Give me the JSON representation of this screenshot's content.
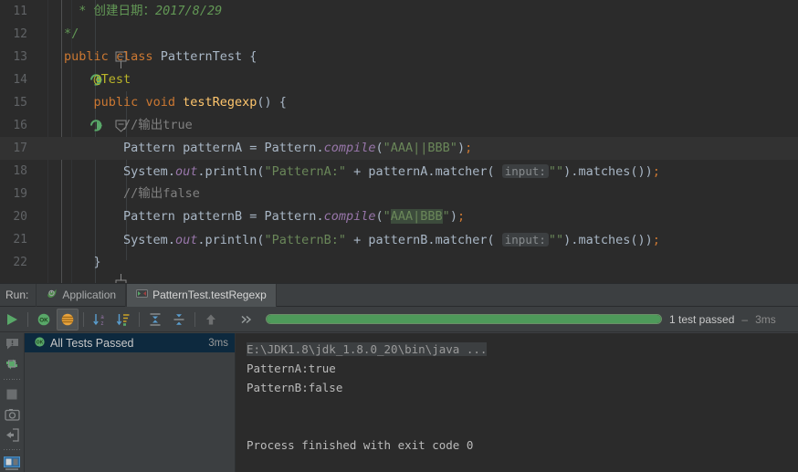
{
  "editor": {
    "lines": [
      {
        "num": "11",
        "gutter": "none",
        "fold": "none",
        "indent": 1,
        "current": false,
        "text": "  * 创建日期：2017/8/29"
      },
      {
        "num": "12",
        "gutter": "none",
        "fold": "fold-end",
        "indent": 1,
        "current": false,
        "text": "  */"
      },
      {
        "num": "13",
        "gutter": "run-class",
        "fold": "none",
        "indent": 0,
        "current": false,
        "text": "public class PatternTest {"
      },
      {
        "num": "14",
        "gutter": "none",
        "fold": "none",
        "indent": 1,
        "current": false,
        "text": "    @Test"
      },
      {
        "num": "15",
        "gutter": "run-method",
        "fold": "fold-open",
        "indent": 1,
        "current": false,
        "text": "    public void testRegexp() {"
      },
      {
        "num": "16",
        "gutter": "none",
        "fold": "none",
        "indent": 2,
        "current": false,
        "text": "        //输出true"
      },
      {
        "num": "17",
        "gutter": "none",
        "fold": "none",
        "indent": 2,
        "current": true,
        "text": "        Pattern patternA = Pattern.compile(\"AAA||BBB\");"
      },
      {
        "num": "18",
        "gutter": "none",
        "fold": "none",
        "indent": 2,
        "current": false,
        "text": "        System.out.println(\"PatternA:\" + patternA.matcher( input: \"\").matches());"
      },
      {
        "num": "19",
        "gutter": "none",
        "fold": "none",
        "indent": 2,
        "current": false,
        "text": "        //输出false"
      },
      {
        "num": "20",
        "gutter": "none",
        "fold": "none",
        "indent": 2,
        "current": false,
        "text": "        Pattern patternB = Pattern.compile(\"AAA|BBB\");"
      },
      {
        "num": "21",
        "gutter": "none",
        "fold": "none",
        "indent": 2,
        "current": false,
        "text": "        System.out.println(\"PatternB:\" + patternB.matcher( input: \"\").matches());"
      },
      {
        "num": "22",
        "gutter": "none",
        "fold": "fold-end",
        "indent": 1,
        "current": false,
        "text": "    }"
      }
    ],
    "tokens": {
      "doc_star": "*",
      "doc_label": "创建日期：",
      "doc_date": "2017/8/29",
      "doc_close": "*/",
      "kw_public": "public",
      "kw_class": "class",
      "kw_void": "void",
      "class_name": "PatternTest",
      "annotation": "@Test",
      "method_name": "testRegexp",
      "comment_true": "//输出true",
      "comment_false": "//输出false",
      "type_pattern": "Pattern",
      "var_a": "patternA",
      "var_b": "patternB",
      "compile": "compile",
      "regex_a": "AAA||BBB",
      "regex_b": "AAA|BBB",
      "system": "System",
      "out": "out",
      "println": "println",
      "label_a": "PatternA:",
      "label_b": "PatternB:",
      "matcher": "matcher",
      "param_hint": "input:",
      "matches": "matches"
    }
  },
  "runpanel": {
    "run_label": "Run:",
    "tabs": [
      {
        "label": "Application",
        "icon": "spring-leaf-icon",
        "active": false
      },
      {
        "label": "PatternTest.testRegexp",
        "icon": "test-run-icon",
        "active": true
      }
    ],
    "toolbar": [
      {
        "name": "rerun-button",
        "icon": "green-play-icon",
        "pressed": false
      },
      {
        "name": "show-passed-button",
        "icon": "ok-badge-icon",
        "pressed": false
      },
      {
        "name": "show-ignored-button",
        "icon": "orange-filter-icon",
        "pressed": true
      },
      {
        "name": "sort-alphabetically-button",
        "icon": "sort-az-icon",
        "pressed": false
      },
      {
        "name": "sort-by-duration-button",
        "icon": "sort-duration-icon",
        "pressed": false
      },
      {
        "name": "expand-all-button",
        "icon": "expand-all-icon",
        "pressed": false
      },
      {
        "name": "collapse-all-button",
        "icon": "collapse-all-icon",
        "pressed": false
      },
      {
        "name": "previous-failed-button",
        "icon": "up-arrow-icon",
        "pressed": false
      },
      {
        "name": "more-options-button",
        "icon": "chevron-double-right-icon",
        "pressed": false
      }
    ],
    "progress": {
      "percent": 100,
      "status": "1 test passed",
      "separator": " – ",
      "time": "3ms",
      "bar_color": "#4e9a5a"
    },
    "rail_icons": [
      "alert-balloon-icon",
      "rerun-tests-icon",
      "stop-icon",
      "screenshot-icon",
      "export-icon",
      "console-layout-icon"
    ],
    "tree": [
      {
        "label": "All Tests Passed",
        "duration": "3ms",
        "icon": "ok-badge-icon",
        "selected": true
      }
    ],
    "console": [
      {
        "text": "E:\\JDK1.8\\jdk_1.8.0_20\\bin\\java ...",
        "style": "command"
      },
      {
        "text": "PatternA:true",
        "style": "plain"
      },
      {
        "text": "PatternB:false",
        "style": "plain"
      },
      {
        "text": "",
        "style": "blank"
      },
      {
        "text": "",
        "style": "blank"
      },
      {
        "text": "Process finished with exit code 0",
        "style": "plain"
      }
    ]
  },
  "colors": {
    "editor_bg": "#2b2b2b",
    "panel_bg": "#3c3f41",
    "current_line": "#323232",
    "selection": "#0d293e",
    "keyword": "#cc7832",
    "string": "#6a8759",
    "comment": "#808080",
    "doc_comment": "#629755",
    "annotation": "#bbb529",
    "method": "#ffc66d",
    "static_field": "#9876aa",
    "default_text": "#a9b7c6",
    "green_accent": "#4e9a5a"
  }
}
